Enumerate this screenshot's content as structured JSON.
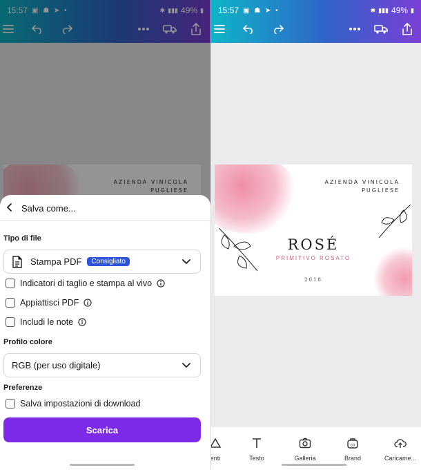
{
  "left": {
    "status": {
      "time": "15:57",
      "battery": "49%"
    },
    "card": {
      "brand_line1": "AZIENDA VINICOLA",
      "brand_line2": "PUGLIESE"
    },
    "sheet": {
      "title": "Salva come...",
      "file_type_label": "Tipo di file",
      "file_type_value": "Stampa PDF",
      "recommended_badge": "Consigliato",
      "options": [
        {
          "label": "Indicatori di taglio e stampa al vivo",
          "checked": false
        },
        {
          "label": "Appiattisci PDF",
          "checked": false
        },
        {
          "label": "Includi le note",
          "checked": false
        }
      ],
      "color_profile_label": "Profilo colore",
      "color_profile_value": "RGB (per uso digitale)",
      "preferences_label": "Preferenze",
      "save_settings_label": "Salva impostazioni di download",
      "download_button": "Scarica"
    }
  },
  "right": {
    "status": {
      "time": "15:57",
      "battery": "49%"
    },
    "card": {
      "brand_line1": "AZIENDA VINICOLA",
      "brand_line2": "PUGLIESE",
      "wine_name": "ROSÉ",
      "wine_sub": "PRIMITIVO ROSATO",
      "year": "2018"
    },
    "bottom_nav": [
      {
        "label": "enti",
        "icon": "elements-icon"
      },
      {
        "label": "Testo",
        "icon": "text-icon"
      },
      {
        "label": "Galleria",
        "icon": "camera-icon"
      },
      {
        "label": "Brand",
        "icon": "brand-icon"
      },
      {
        "label": "Caricame...",
        "icon": "upload-cloud-icon"
      }
    ]
  },
  "colors": {
    "accent": "#7d2ae8",
    "badge": "#2d55d8"
  }
}
